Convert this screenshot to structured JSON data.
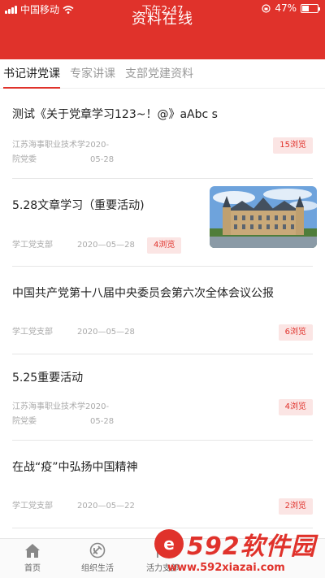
{
  "status_bar": {
    "carrier": "中国移动",
    "time": "下午2:47",
    "battery": "47%",
    "battery_level": 0.47
  },
  "header": {
    "title": "资料在线"
  },
  "tabs": [
    {
      "label": "书记讲党课",
      "active": true
    },
    {
      "label": "专家讲课",
      "active": false
    },
    {
      "label": "支部党建资料",
      "active": false
    }
  ],
  "articles": [
    {
      "title": "测试《关于党章学习123~！@》aAbc s",
      "dept": "江苏海事职业技术学2020-\n院党委",
      "date": "05-28",
      "views": "15浏览"
    },
    {
      "title": "5.28文章学习（重要活动)",
      "dept": "学工党支部",
      "date": "2020—05—28",
      "views": "4浏览",
      "has_image": true
    },
    {
      "title": "中国共产党第十八届中央委员会第六次全体会议公报",
      "dept": "学工党支部",
      "date": "2020—05—28",
      "views": "6浏览"
    },
    {
      "title": "5.25重要活动",
      "dept": "江苏海事职业技术学2020-\n院党委",
      "date": "05-28",
      "views": "4浏览"
    },
    {
      "title": "在战“疫”中弘扬中国精神",
      "dept": "学工党支部",
      "date": "2020—05—22",
      "views": "2浏览"
    }
  ],
  "tabbar": [
    {
      "label": "首页",
      "icon": "home-icon"
    },
    {
      "label": "组织生活",
      "icon": "party-emblem-icon"
    },
    {
      "label": "活力支部",
      "icon": "flag-icon"
    }
  ],
  "watermark": {
    "big": "592软件园",
    "url": "www.592xiazai.com"
  },
  "colors": {
    "accent": "#e0322b",
    "badge_bg": "#fbe5e4"
  }
}
